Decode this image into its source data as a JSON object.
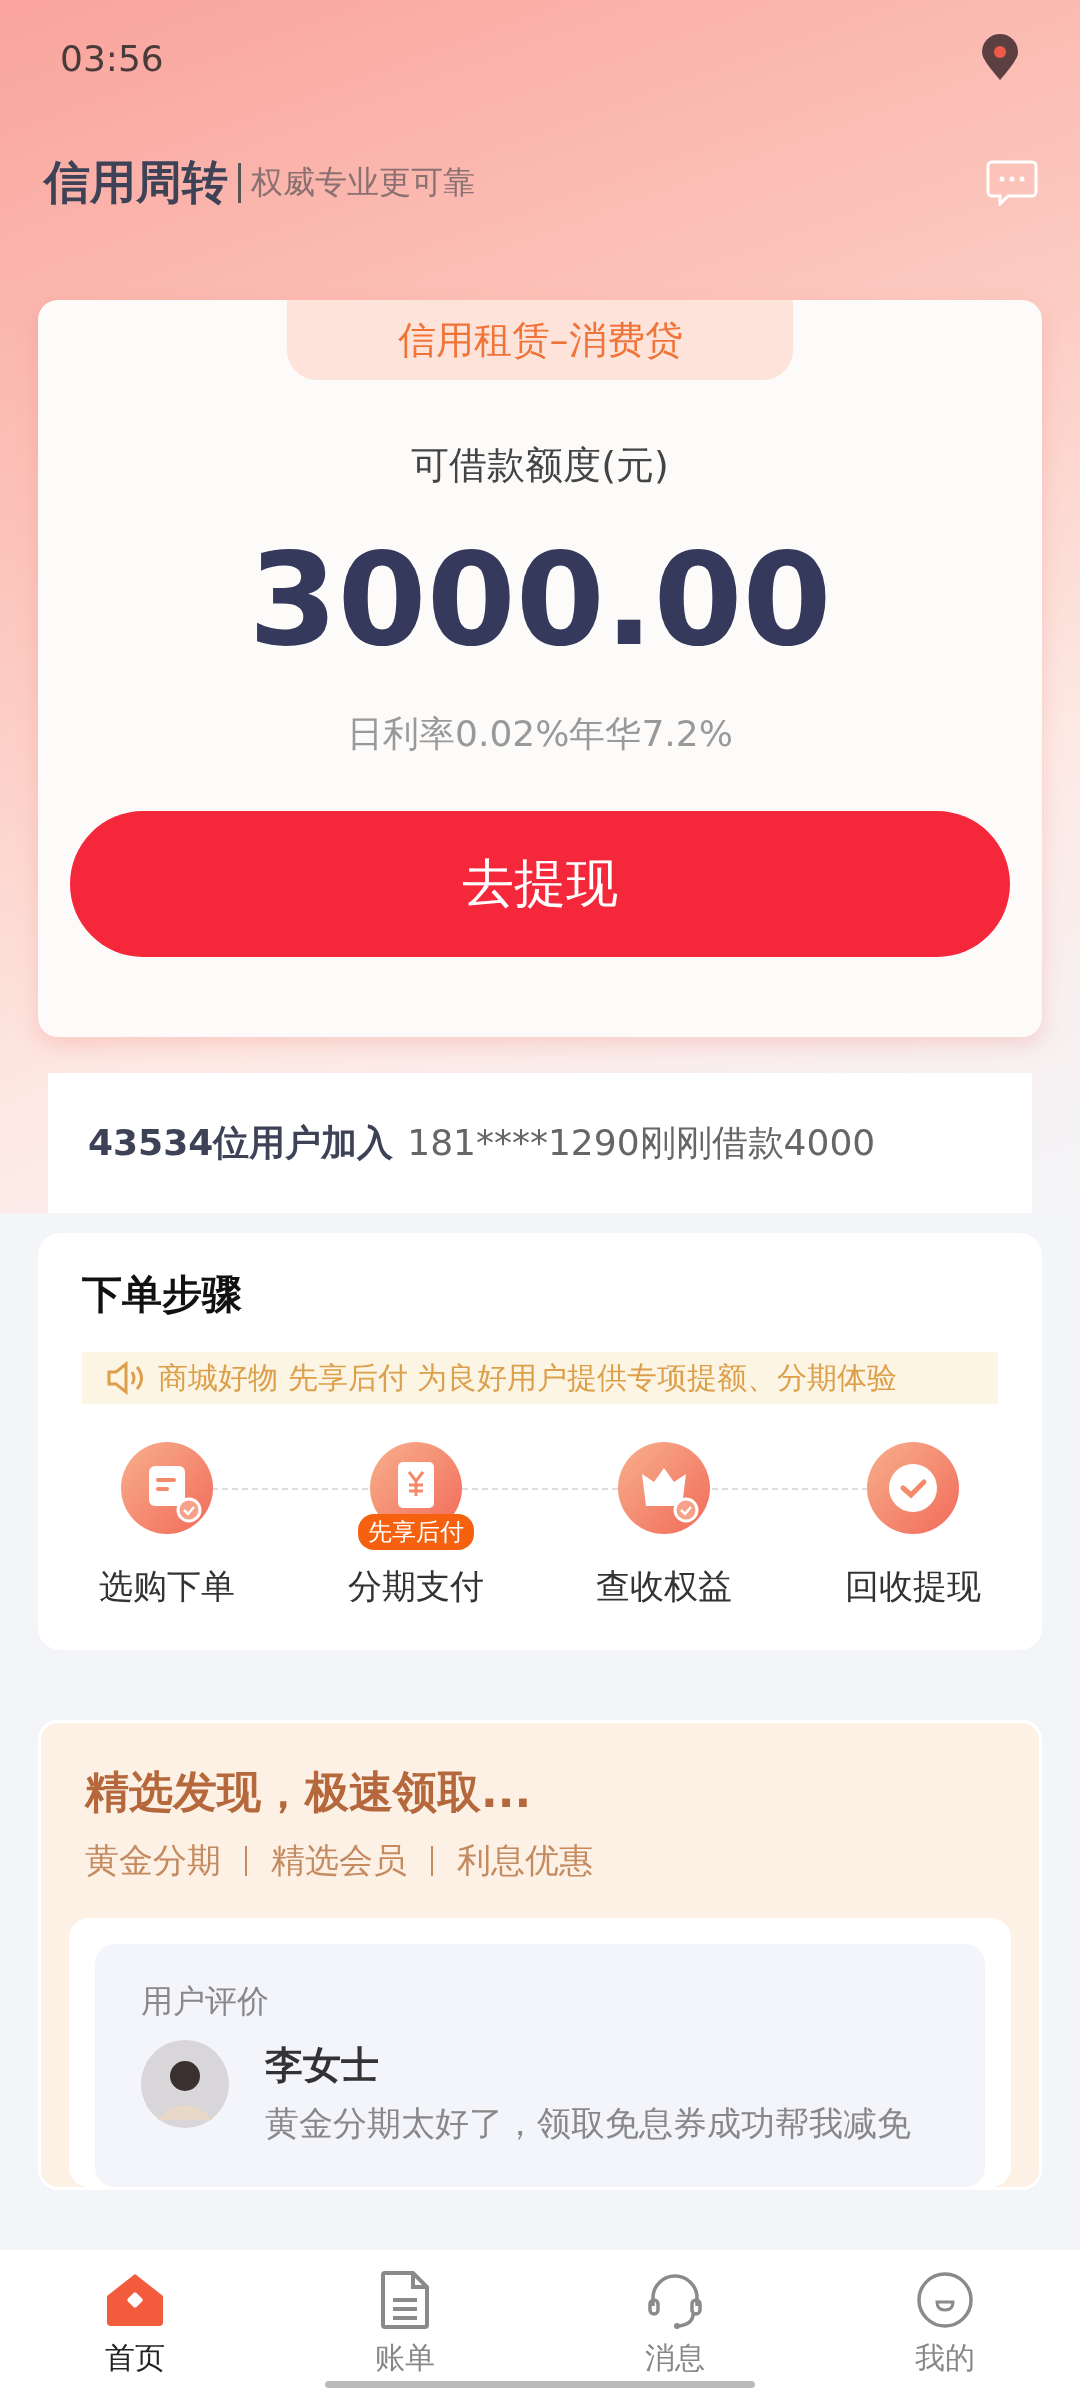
{
  "status_bar": {
    "time": "03:56"
  },
  "header": {
    "title": "信用周转",
    "slogan": "权威专业更可靠"
  },
  "loan_card": {
    "tab": "信用租赁–消费贷",
    "label": "可借款额度(元)",
    "amount": "3000.00",
    "rate": "日利率0.02%年华7.2%",
    "button": "去提现"
  },
  "ticker": {
    "count": "43534位用户加入",
    "message": "181****1290刚刚借款4000"
  },
  "steps": {
    "title": "下单步骤",
    "notice": "商城好物 先享后付 为良好用户提供专项提额、分期体验",
    "items": [
      {
        "kind": "order",
        "label": "选购下单"
      },
      {
        "kind": "pay",
        "label": "分期支付",
        "badge": "先享后付"
      },
      {
        "kind": "benefit",
        "label": "查收权益"
      },
      {
        "kind": "withdraw",
        "label": "回收提现"
      }
    ]
  },
  "discover": {
    "title": "精选发现，极速领取...",
    "tags": [
      "黄金分期",
      "精选会员",
      "利息优惠"
    ],
    "review": {
      "heading": "用户评价",
      "name": "李女士",
      "text": "黄金分期太好了，领取免息券成功帮我减免"
    }
  },
  "tab_bar": [
    {
      "kind": "home",
      "label": "首页",
      "selected": true
    },
    {
      "kind": "bill",
      "label": "账单",
      "selected": false
    },
    {
      "kind": "message",
      "label": "消息",
      "selected": false
    },
    {
      "kind": "mine",
      "label": "我的",
      "selected": false
    }
  ]
}
